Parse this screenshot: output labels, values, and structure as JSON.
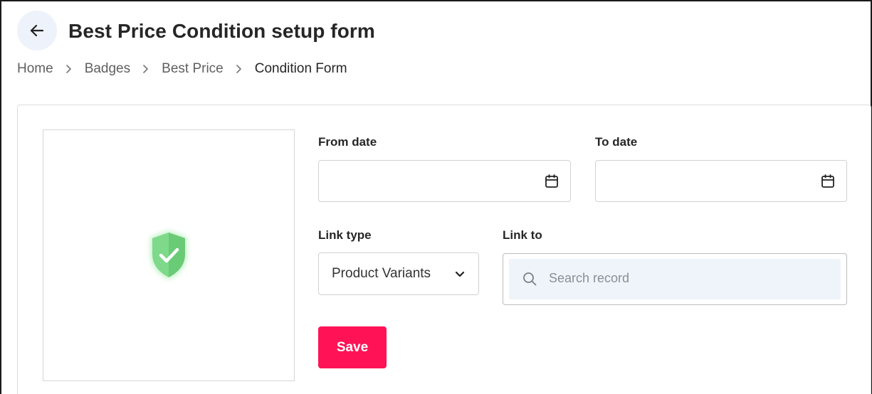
{
  "header": {
    "title": "Best Price Condition setup form",
    "back_icon": "arrow-left-icon"
  },
  "breadcrumb": [
    {
      "label": "Home"
    },
    {
      "label": "Badges"
    },
    {
      "label": "Best Price"
    },
    {
      "label": "Condition Form"
    }
  ],
  "image": {
    "icon": "shield-check-icon",
    "color": "#7ed98a"
  },
  "form": {
    "from_date": {
      "label": "From date",
      "value": "",
      "icon": "calendar-icon"
    },
    "to_date": {
      "label": "To date",
      "value": "",
      "icon": "calendar-icon"
    },
    "link_type": {
      "label": "Link type",
      "value": "Product Variants"
    },
    "link_to": {
      "label": "Link to",
      "placeholder": "Search record",
      "icon": "search-icon"
    },
    "save_label": "Save"
  },
  "colors": {
    "accent": "#ff1356",
    "search_bg": "#eff4fb",
    "back_button_bg": "#eef2fa"
  }
}
